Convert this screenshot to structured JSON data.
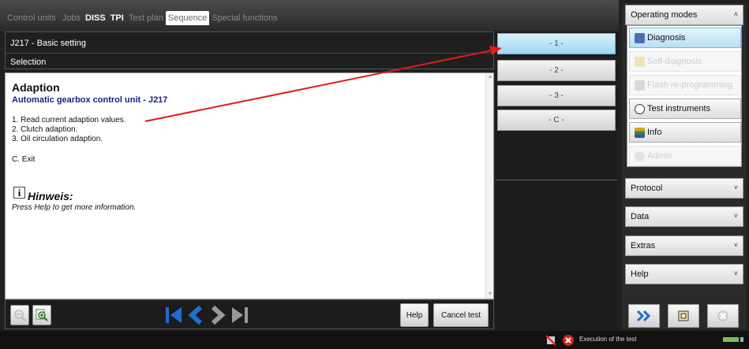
{
  "tabs": [
    {
      "label": "Control units",
      "bold": false,
      "active": false
    },
    {
      "label": "Jobs",
      "bold": false,
      "active": false
    },
    {
      "label": "DISS",
      "bold": true,
      "active": false
    },
    {
      "label": "TPI",
      "bold": true,
      "active": false
    },
    {
      "label": "Test plan",
      "bold": false,
      "active": false
    },
    {
      "label": "Sequence",
      "bold": false,
      "active": true
    },
    {
      "label": "Special functions",
      "bold": false,
      "active": false
    }
  ],
  "header": {
    "title": "J217 - Basic setting",
    "subtitle": "Selection"
  },
  "content": {
    "title": "Adaption",
    "subtitle": "Automatic gearbox control unit - J217",
    "options": [
      "1. Read current adaption values.",
      "2. Clutch adaption.",
      "3. Oil circulation adaption."
    ],
    "exit": "C. Exit",
    "hint_title": "Hinweis:",
    "hint_text": "Press Help to get more information."
  },
  "toolbar": {
    "help": "Help",
    "cancel": "Cancel test"
  },
  "sequence_buttons": [
    "- 1 -",
    "- 2 -",
    "- 3 -",
    "- C -"
  ],
  "side": {
    "operating_modes": "Operating modes",
    "modes": [
      {
        "label": "Diagnosis",
        "state": "selected",
        "icon": "stethoscope-icon",
        "color": "#4a6fb5"
      },
      {
        "label": "Self-diagnosis",
        "state": "disabled",
        "icon": "book-icon",
        "color": "#e8d9a0"
      },
      {
        "label": "Flash re-programming",
        "state": "disabled",
        "icon": "flash-icon",
        "color": "#cfcfcf"
      },
      {
        "label": "Test instruments",
        "state": "normal",
        "icon": "gauge-icon",
        "color": "#666666"
      },
      {
        "label": "Info",
        "state": "normal",
        "icon": "books-icon",
        "color": "#3a8a2f"
      },
      {
        "label": "Admin",
        "state": "disabled",
        "icon": "admin-icon",
        "color": "#dddddd"
      }
    ],
    "sections": [
      "Protocol",
      "Data",
      "Extras",
      "Help"
    ]
  },
  "status": {
    "text": "Execution of the test"
  },
  "colors": {
    "accent": "#9fd8f0",
    "arrow": "#e21b1b",
    "link": "#1a237e"
  }
}
